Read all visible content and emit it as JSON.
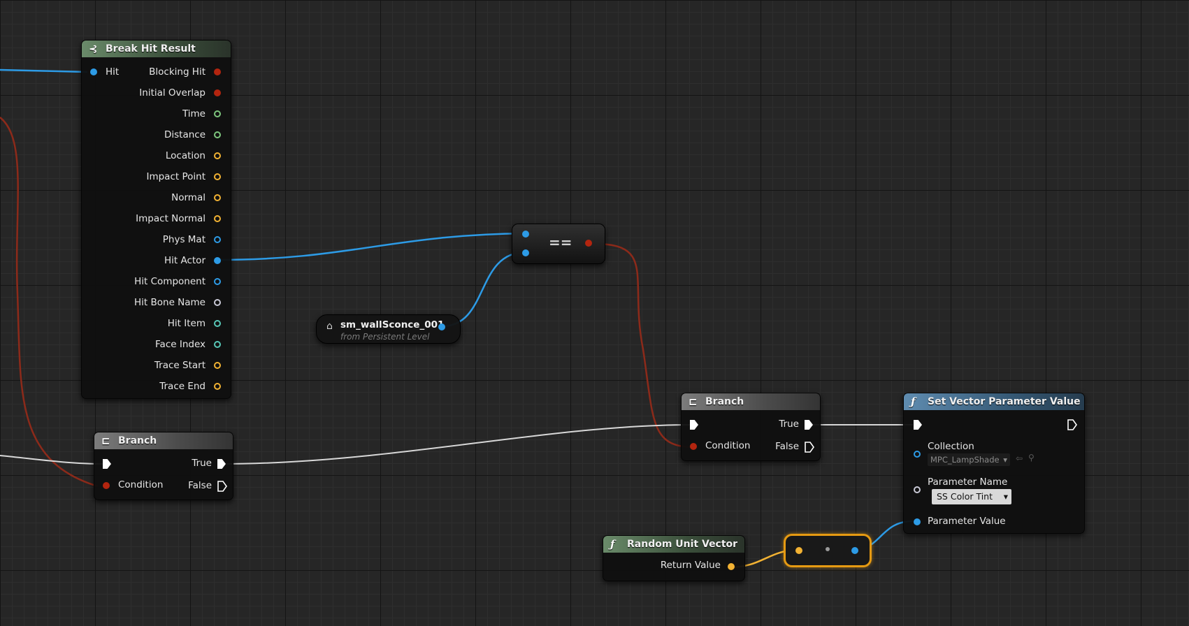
{
  "break_hit_result": {
    "title": "Break Hit Result",
    "input_label": "Hit",
    "outputs": [
      {
        "label": "Blocking Hit",
        "color": "#b3250f",
        "filled": true
      },
      {
        "label": "Initial Overlap",
        "color": "#b3250f",
        "filled": true
      },
      {
        "label": "Time",
        "color": "#7ec77e",
        "filled": false
      },
      {
        "label": "Distance",
        "color": "#7ec77e",
        "filled": false
      },
      {
        "label": "Location",
        "color": "#f2b233",
        "filled": false
      },
      {
        "label": "Impact Point",
        "color": "#f2b233",
        "filled": false
      },
      {
        "label": "Normal",
        "color": "#f2b233",
        "filled": false
      },
      {
        "label": "Impact Normal",
        "color": "#f2b233",
        "filled": false
      },
      {
        "label": "Phys Mat",
        "color": "#2d9be6",
        "filled": false
      },
      {
        "label": "Hit Actor",
        "color": "#2d9be6",
        "filled": true
      },
      {
        "label": "Hit Component",
        "color": "#2d9be6",
        "filled": false
      },
      {
        "label": "Hit Bone Name",
        "color": "#c9c9d6",
        "filled": false
      },
      {
        "label": "Hit Item",
        "color": "#58c7b7",
        "filled": false
      },
      {
        "label": "Face Index",
        "color": "#58c7b7",
        "filled": false
      },
      {
        "label": "Trace Start",
        "color": "#f2b233",
        "filled": false
      },
      {
        "label": "Trace End",
        "color": "#f2b233",
        "filled": false
      }
    ]
  },
  "branch_left": {
    "title": "Branch",
    "true_label": "True",
    "condition_label": "Condition",
    "false_label": "False"
  },
  "branch_right": {
    "title": "Branch",
    "true_label": "True",
    "condition_label": "Condition",
    "false_label": "False"
  },
  "equal_node": {
    "symbol": "=="
  },
  "actor_ref": {
    "name": "sm_wallSconce_001",
    "subtitle": "from Persistent Level"
  },
  "set_vector_param": {
    "title": "Set Vector Parameter Value",
    "collection_label": "Collection",
    "collection_value": "MPC_LampShade",
    "param_name_label": "Parameter Name",
    "param_name_value": "SS Color Tint",
    "param_value_label": "Parameter Value"
  },
  "random_unit_vector": {
    "title": "Random Unit Vector",
    "return_label": "Return Value"
  },
  "colors": {
    "exec": "#ffffff",
    "bool": "#b3250f",
    "object": "#2d9be6",
    "vector": "#f2b233",
    "float": "#7ec77e",
    "reroute_highlight": "#e69a12"
  }
}
